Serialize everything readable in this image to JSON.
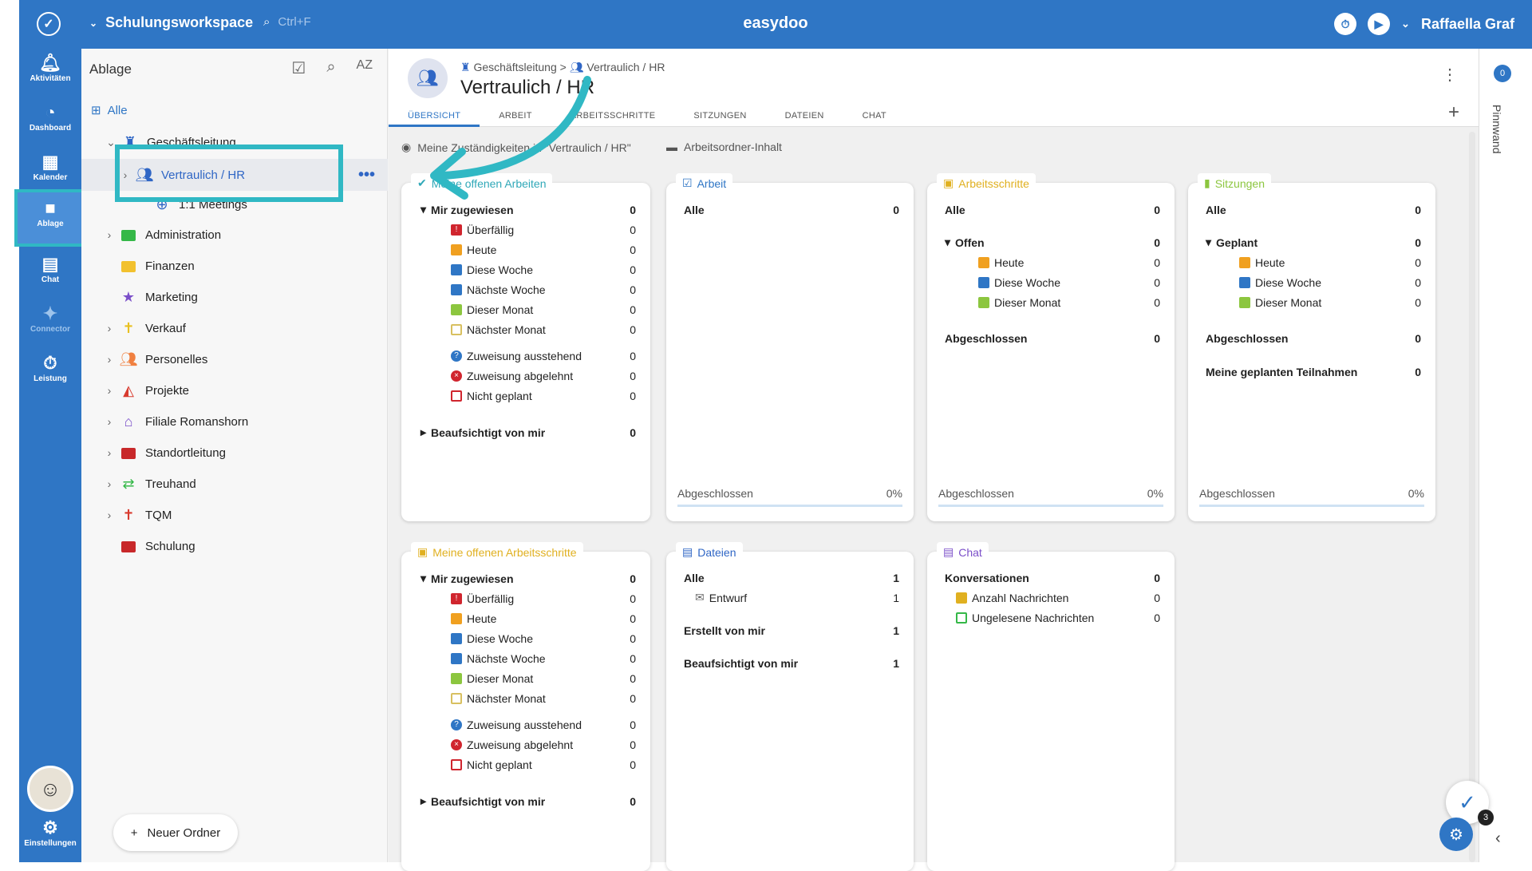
{
  "topbar": {
    "workspace": "Schulungsworkspace",
    "search_hint": "Ctrl+F",
    "brand": "easydoo",
    "user": "Raffaella Graf"
  },
  "leftnav": [
    {
      "label": "Aktivitäten",
      "icon": "bell-icon"
    },
    {
      "label": "Dashboard",
      "icon": "gauge-icon"
    },
    {
      "label": "Kalender",
      "icon": "calendar-icon"
    },
    {
      "label": "Ablage",
      "icon": "folder-icon"
    },
    {
      "label": "Chat",
      "icon": "chat-icon"
    },
    {
      "label": "Connector",
      "icon": "sparkle-icon"
    },
    {
      "label": "Leistung",
      "icon": "stopwatch-icon"
    },
    {
      "label": "Einstellungen",
      "icon": "gear-icon"
    }
  ],
  "sidebar": {
    "title": "Ablage",
    "all": "Alle",
    "new_folder": "Neuer Ordner",
    "items": [
      {
        "label": "Geschäftsleitung",
        "color": "#2f66c5"
      },
      {
        "label": "Vertraulich / HR",
        "color": "#2f66c5"
      },
      {
        "label": "1:1 Meetings",
        "color": "#2f66c5"
      },
      {
        "label": "Administration",
        "color": "#35b848"
      },
      {
        "label": "Finanzen",
        "color": "#f2c12e"
      },
      {
        "label": "Marketing",
        "color": "#7b4fc9"
      },
      {
        "label": "Verkauf",
        "color": "#e8c020"
      },
      {
        "label": "Personelles",
        "color": "#f08040"
      },
      {
        "label": "Projekte",
        "color": "#d83a2e"
      },
      {
        "label": "Filiale Romanshorn",
        "color": "#7b4fc9"
      },
      {
        "label": "Standortleitung",
        "color": "#c8282a"
      },
      {
        "label": "Treuhand",
        "color": "#35b848"
      },
      {
        "label": "TQM",
        "color": "#d83a2e"
      },
      {
        "label": "Schulung",
        "color": "#c8282a"
      }
    ]
  },
  "header": {
    "crumb_parent": "Geschäftsleitung",
    "crumb_sep": ">",
    "crumb_current": "Vertraulich / HR",
    "title": "Vertraulich / HR",
    "tabs": [
      "ÜBERSICHT",
      "ARBEIT",
      "ARBEITSSCHRITTE",
      "SITZUNGEN",
      "DATEIEN",
      "CHAT"
    ]
  },
  "sections": {
    "left": "Meine Zuständigkeiten in \"Vertraulich / HR\"",
    "right": "Arbeitsordner-Inhalt"
  },
  "card_arbeiten": {
    "title": "Meine offenen Arbeiten",
    "rows": [
      {
        "label": "Mir zugewiesen",
        "value": "0"
      },
      {
        "label": "Überfällig",
        "value": "0"
      },
      {
        "label": "Heute",
        "value": "0"
      },
      {
        "label": "Diese Woche",
        "value": "0"
      },
      {
        "label": "Nächste Woche",
        "value": "0"
      },
      {
        "label": "Dieser Monat",
        "value": "0"
      },
      {
        "label": "Nächster Monat",
        "value": "0"
      },
      {
        "label": "Zuweisung ausstehend",
        "value": "0"
      },
      {
        "label": "Zuweisung abgelehnt",
        "value": "0"
      },
      {
        "label": "Nicht geplant",
        "value": "0"
      },
      {
        "label": "Beaufsichtigt von mir",
        "value": "0"
      }
    ]
  },
  "card_schritte": {
    "title": "Meine offenen Arbeitsschritte",
    "rows": [
      {
        "label": "Mir zugewiesen",
        "value": "0"
      },
      {
        "label": "Überfällig",
        "value": "0"
      },
      {
        "label": "Heute",
        "value": "0"
      },
      {
        "label": "Diese Woche",
        "value": "0"
      },
      {
        "label": "Nächste Woche",
        "value": "0"
      },
      {
        "label": "Dieser Monat",
        "value": "0"
      },
      {
        "label": "Nächster Monat",
        "value": "0"
      },
      {
        "label": "Zuweisung ausstehend",
        "value": "0"
      },
      {
        "label": "Zuweisung abgelehnt",
        "value": "0"
      },
      {
        "label": "Nicht geplant",
        "value": "0"
      },
      {
        "label": "Beaufsichtigt von mir",
        "value": "0"
      }
    ]
  },
  "card_arbeit": {
    "title": "Arbeit",
    "rows": [
      {
        "label": "Alle",
        "value": "0"
      }
    ],
    "footer": {
      "label": "Abgeschlossen",
      "value": "0%"
    }
  },
  "card_as": {
    "title": "Arbeitsschritte",
    "rows": [
      {
        "label": "Alle",
        "value": "0"
      },
      {
        "label": "Offen",
        "value": "0"
      },
      {
        "label": "Heute",
        "value": "0"
      },
      {
        "label": "Diese Woche",
        "value": "0"
      },
      {
        "label": "Dieser Monat",
        "value": "0"
      },
      {
        "label": "Abgeschlossen",
        "value": "0"
      }
    ],
    "footer": {
      "label": "Abgeschlossen",
      "value": "0%"
    }
  },
  "card_sitzungen": {
    "title": "Sitzungen",
    "rows": [
      {
        "label": "Alle",
        "value": "0"
      },
      {
        "label": "Geplant",
        "value": "0"
      },
      {
        "label": "Heute",
        "value": "0"
      },
      {
        "label": "Diese Woche",
        "value": "0"
      },
      {
        "label": "Dieser Monat",
        "value": "0"
      },
      {
        "label": "Abgeschlossen",
        "value": "0"
      },
      {
        "label": "Meine geplanten Teilnahmen",
        "value": "0"
      }
    ],
    "footer": {
      "label": "Abgeschlossen",
      "value": "0%"
    }
  },
  "card_dateien": {
    "title": "Dateien",
    "rows": [
      {
        "label": "Alle",
        "value": "1"
      },
      {
        "label": "Entwurf",
        "value": "1"
      },
      {
        "label": "Erstellt von mir",
        "value": "1"
      },
      {
        "label": "Beaufsichtigt von mir",
        "value": "1"
      }
    ]
  },
  "card_chat": {
    "title": "Chat",
    "rows": [
      {
        "label": "Konversationen",
        "value": "0"
      },
      {
        "label": "Anzahl Nachrichten",
        "value": "0"
      },
      {
        "label": "Ungelesene Nachrichten",
        "value": "0"
      }
    ]
  },
  "pinnwand": {
    "label": "Pinnwand",
    "badge": "0"
  },
  "fab_badge": "3"
}
